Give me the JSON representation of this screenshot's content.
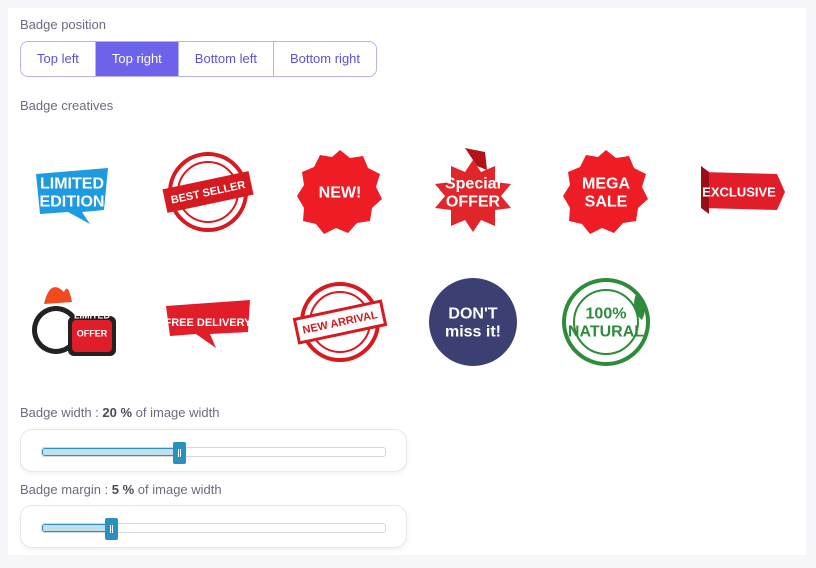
{
  "position": {
    "label": "Badge position",
    "options": [
      "Top left",
      "Top right",
      "Bottom left",
      "Bottom right"
    ],
    "selected": "Top right"
  },
  "creatives": {
    "label": "Badge creatives",
    "badges": [
      {
        "name": "limited-edition",
        "lines": [
          "LIMITED",
          "EDITION"
        ],
        "color": "#1e9be0"
      },
      {
        "name": "best-seller",
        "lines": [
          "BEST SELLER"
        ],
        "color": "#d71920"
      },
      {
        "name": "new",
        "lines": [
          "NEW!"
        ],
        "color": "#ee1c25"
      },
      {
        "name": "special-offer",
        "lines": [
          "Special",
          "OFFER"
        ],
        "color": "#e0262b"
      },
      {
        "name": "mega-sale",
        "lines": [
          "MEGA",
          "SALE"
        ],
        "color": "#ee1c25"
      },
      {
        "name": "exclusive",
        "lines": [
          "EXCLUSIVE"
        ],
        "color": "#e11d2a"
      },
      {
        "name": "limited-offer",
        "lines": [
          "LIMITED",
          "OFFER"
        ],
        "color": "#e11d2a"
      },
      {
        "name": "free-delivery",
        "lines": [
          "FREE DELIVERY"
        ],
        "color": "#e11d2a"
      },
      {
        "name": "new-arrival",
        "lines": [
          "NEW ARRIVAL"
        ],
        "color": "#d71920"
      },
      {
        "name": "dont-miss-it",
        "lines": [
          "DON'T",
          "miss it!"
        ],
        "color": "#3c3f72"
      },
      {
        "name": "100-natural",
        "lines": [
          "100%",
          "NATURAL"
        ],
        "color": "#2e8b3a"
      }
    ]
  },
  "width_slider": {
    "prefix": "Badge width : ",
    "value": "20 %",
    "suffix": " of image width",
    "fill_fraction": 0.4
  },
  "margin_slider": {
    "prefix": "Badge margin : ",
    "value": "5 %",
    "suffix": " of image width",
    "fill_fraction": 0.2
  },
  "colors": {
    "accent": "#6c63ea",
    "slider": "#2b8fc0"
  }
}
